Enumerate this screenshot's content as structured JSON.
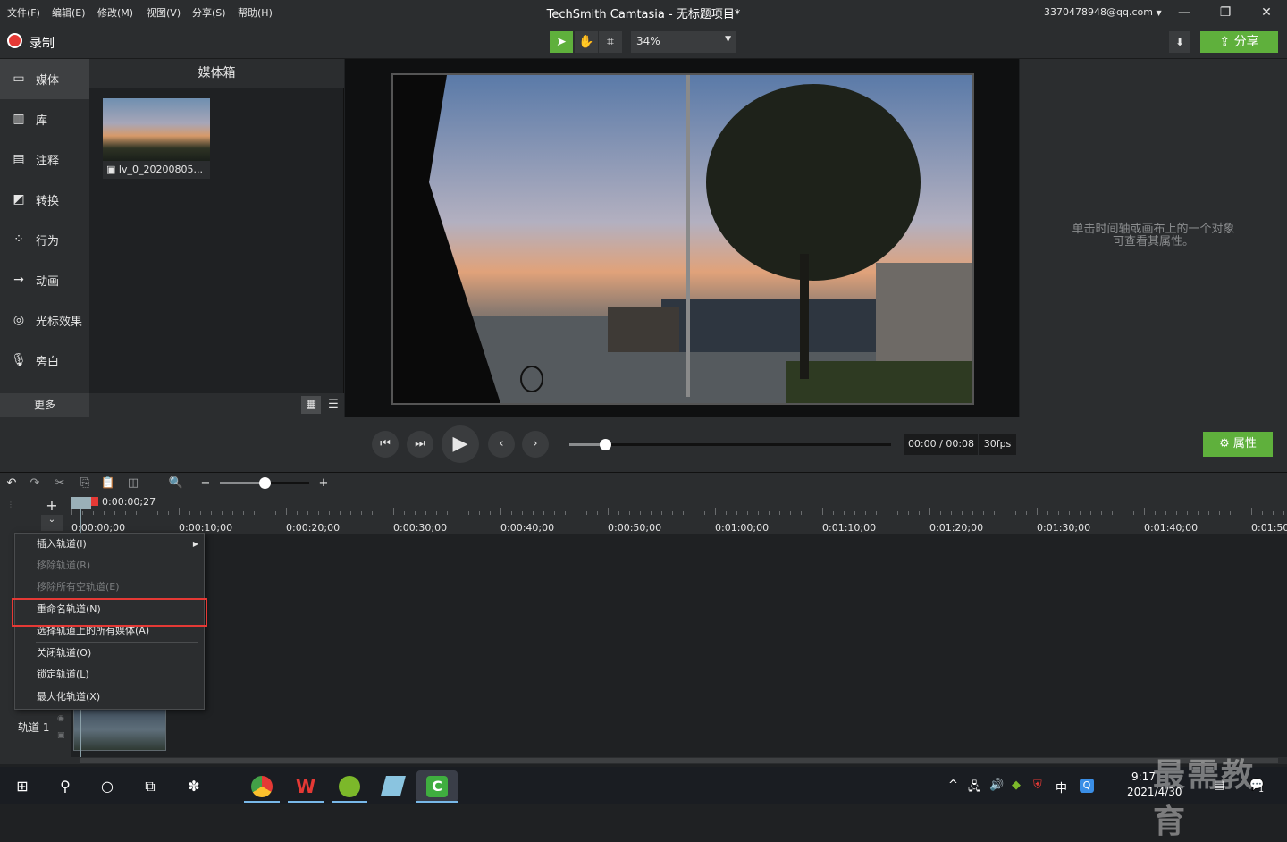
{
  "menu": {
    "file": "文件(F)",
    "edit": "编辑(E)",
    "modify": "修改(M)",
    "view": "视图(V)",
    "share": "分享(S)",
    "help": "帮助(H)"
  },
  "window": {
    "title": "TechSmith Camtasia - 无标题项目*",
    "account": "3370478948@qq.com"
  },
  "toolbar": {
    "record_label": "录制",
    "zoom_value": "34%",
    "share_label": "分享"
  },
  "sidebar": {
    "items": [
      {
        "label": "媒体",
        "icon": "media-icon"
      },
      {
        "label": "库",
        "icon": "library-icon"
      },
      {
        "label": "注释",
        "icon": "annotation-icon"
      },
      {
        "label": "转换",
        "icon": "transition-icon"
      },
      {
        "label": "行为",
        "icon": "behavior-icon"
      },
      {
        "label": "动画",
        "icon": "animation-icon"
      },
      {
        "label": "光标效果",
        "icon": "cursor-effect-icon"
      },
      {
        "label": "旁白",
        "icon": "microphone-icon"
      }
    ],
    "more_label": "更多"
  },
  "media_bin": {
    "title": "媒体箱",
    "items": [
      {
        "label": "lv_0_20200805..."
      }
    ]
  },
  "properties": {
    "hint_line1": "单击时间轴或画布上的一个对象",
    "hint_line2": "可查看其属性。",
    "button_label": "属性"
  },
  "playback": {
    "time": "00:00 / 00:08",
    "fps": "30fps",
    "progress": 0.11
  },
  "timeline": {
    "playhead_time": "0:00:00;27",
    "zoom_level": 0.5,
    "ticks": [
      "0:00:00;00",
      "0:00:10;00",
      "0:00:20;00",
      "0:00:30;00",
      "0:00:40;00",
      "0:00:50;00",
      "0:01:00;00",
      "0:01:10;00",
      "0:01:20;00",
      "0:01:30;00",
      "0:01:40;00",
      "0:01:50;"
    ],
    "track1_label": "轨道 1"
  },
  "context_menu": {
    "items": [
      {
        "label": "插入轨道(I)",
        "disabled": false,
        "submenu": true
      },
      {
        "label": "移除轨道(R)",
        "disabled": true
      },
      {
        "label": "移除所有空轨道(E)",
        "disabled": true
      },
      {
        "label": "重命名轨道(N)",
        "disabled": false,
        "highlighted": true
      },
      {
        "label": "选择轨道上的所有媒体(A)",
        "disabled": false
      },
      {
        "label": "关闭轨道(O)",
        "disabled": false
      },
      {
        "label": "锁定轨道(L)",
        "disabled": false
      },
      {
        "label": "最大化轨道(X)",
        "disabled": false
      }
    ]
  },
  "taskbar": {
    "time": "9:17",
    "date": "2021/4/30",
    "ime": "中",
    "notification_count": "1"
  },
  "watermark": "最需教育",
  "colors": {
    "accent_green": "#5fb03c",
    "record_red": "#e53935",
    "highlight_red": "#e53935"
  }
}
